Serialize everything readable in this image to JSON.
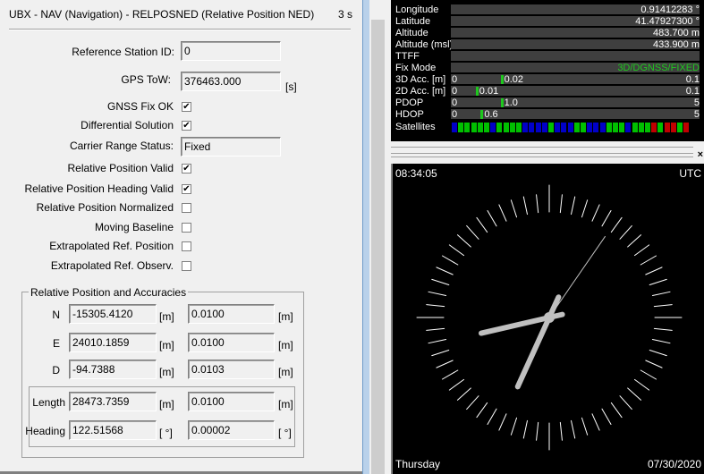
{
  "header": {
    "title": "UBX - NAV (Navigation) - RELPOSNED (Relative Position NED)",
    "age": "3 s"
  },
  "fields": {
    "ref_station_label": "Reference Station ID:",
    "ref_station_value": "0",
    "gps_tow_label": "GPS ToW:",
    "gps_tow_value": "376463.000",
    "gps_tow_unit": "[s]",
    "carrier_label": "Carrier Range Status:",
    "carrier_value": "Fixed"
  },
  "flags": [
    {
      "label": "GNSS Fix OK",
      "checked": true
    },
    {
      "label": "Differential Solution",
      "checked": true
    },
    {
      "label": "Relative Position Valid",
      "checked": true
    },
    {
      "label": "Relative Position Heading Valid",
      "checked": true
    },
    {
      "label": "Relative Position Normalized",
      "checked": false
    },
    {
      "label": "Moving Baseline",
      "checked": false
    },
    {
      "label": "Extrapolated Ref. Position",
      "checked": false
    },
    {
      "label": "Extrapolated Ref. Observ.",
      "checked": false
    }
  ],
  "flag_marks": [
    "✔",
    "✔",
    "✔",
    "✔",
    "",
    "",
    "",
    ""
  ],
  "relpos": {
    "title": "Relative Position and Accuracies",
    "rows": [
      {
        "label": "N",
        "value": "-15305.4120",
        "unit": "[m]",
        "acc": "0.0100",
        "acc_unit": "[m]"
      },
      {
        "label": "E",
        "value": "24010.1859",
        "unit": "[m]",
        "acc": "0.0100",
        "acc_unit": "[m]"
      },
      {
        "label": "D",
        "value": "-94.7388",
        "unit": "[m]",
        "acc": "0.0103",
        "acc_unit": "[m]"
      },
      {
        "label": "Length",
        "value": "28473.7359",
        "unit": "[m]",
        "acc": "0.0100",
        "acc_unit": "[m]"
      },
      {
        "label": "Heading",
        "value": "122.51568",
        "unit": "[ °]",
        "acc": "0.00002",
        "acc_unit": "[ °]"
      }
    ]
  },
  "gps": {
    "rows": [
      {
        "label": "Longitude",
        "value": "0.91412283 °"
      },
      {
        "label": "Latitude",
        "value": "41.47927300 °"
      },
      {
        "label": "Altitude",
        "value": "483.700 m"
      },
      {
        "label": "Altitude (msl)",
        "value": "433.900 m"
      },
      {
        "label": "TTFF",
        "value": ""
      },
      {
        "label": "Fix Mode",
        "value": "3D/DGNSS/FIXED"
      },
      {
        "label": "3D Acc. [m]",
        "min": "0",
        "value": "0.02",
        "max": "0.1",
        "fraction": 0.2
      },
      {
        "label": "2D Acc. [m]",
        "min": "0",
        "value": "0.01",
        "max": "0.1",
        "fraction": 0.1
      },
      {
        "label": "PDOP",
        "min": "0",
        "value": "1.0",
        "max": "5",
        "fraction": 0.2
      },
      {
        "label": "HDOP",
        "min": "0",
        "value": "0.6",
        "max": "5",
        "fraction": 0.12
      }
    ],
    "satellites_label": "Satellites",
    "satellites": [
      "blue",
      "green",
      "green",
      "green",
      "green",
      "green",
      "blue",
      "green",
      "green",
      "green",
      "green",
      "blue",
      "blue",
      "blue",
      "blue",
      "green",
      "blue",
      "blue",
      "blue",
      "green",
      "green",
      "blue",
      "blue",
      "blue",
      "green",
      "green",
      "green",
      "blue",
      "green",
      "green",
      "green",
      "red",
      "green",
      "red",
      "red",
      "green",
      "red"
    ],
    "colors": {
      "green": "#00c000",
      "blue": "#0000c8",
      "red": "#c00000",
      "fix": "#1ec81e"
    }
  },
  "clock": {
    "time": "08:34:05",
    "timezone": "UTC",
    "day": "Thursday",
    "date": "07/30/2020",
    "hours": 8,
    "minutes": 34,
    "seconds": 5
  }
}
